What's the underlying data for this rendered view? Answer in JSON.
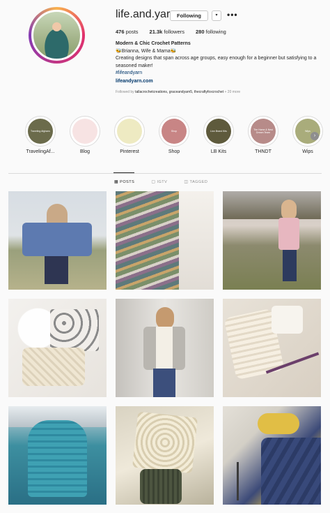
{
  "profile": {
    "username": "life.and.yarn",
    "follow_label": "Following",
    "dropdown_icon": "▾",
    "more_icon": "•••",
    "posts": "476",
    "posts_label": "posts",
    "followers": "21.3k",
    "followers_label": "followers",
    "following": "280",
    "following_label": "following"
  },
  "bio": {
    "name": "Modern & Chic Crochet Patterns",
    "line1": "🐝Brianna, Wife & Mama🐝",
    "line2": "Creating designs that span across age groups, easy enough for a beginner but satisfying to a seasoned maker!",
    "hashtag": "#lifeandyarn",
    "link": "lifeandyarn.com",
    "followed_prefix": "Followed by",
    "followed_names": "tallacrochetcreations, graceandyarn5, thecraftyfoxcrochet",
    "followed_more": "+ 20 more"
  },
  "highlights": [
    {
      "label": "TravelingAf...",
      "circle_text": "Traveling Afghans",
      "color": "#6b6b4b"
    },
    {
      "label": "Blog",
      "circle_text": "",
      "color": "#f7e3e3"
    },
    {
      "label": "Pinterest",
      "circle_text": "",
      "color": "#eeeac2"
    },
    {
      "label": "Shop",
      "circle_text": "Shop",
      "color": "#c88585"
    },
    {
      "label": "LB Kits",
      "circle_text": "Lion Brand Kits",
      "color": "#5e5a3c"
    },
    {
      "label": "THNDT",
      "circle_text": "The Home & Nest Dream Team",
      "color": "#b78b89"
    },
    {
      "label": "Wips",
      "circle_text": "Wips",
      "color": "#a9ac7b"
    }
  ],
  "highlight_arrow": "›",
  "tabs": [
    {
      "label": "POSTS",
      "icon": "▦"
    },
    {
      "label": "IGTV",
      "icon": "▢"
    },
    {
      "label": "TAGGED",
      "icon": "◫"
    }
  ]
}
